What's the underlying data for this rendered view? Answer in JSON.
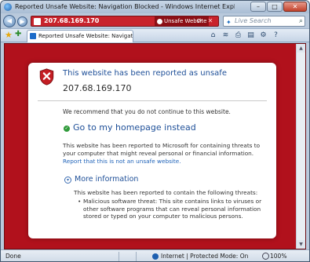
{
  "window": {
    "title": "Reported Unsafe Website: Navigation Blocked - Windows Internet Explorer",
    "controls": {
      "minimize": "–",
      "maximize": "□",
      "close": "✕"
    }
  },
  "address_bar": {
    "url": "207.68.169.170",
    "badge": "Unsafe Website",
    "accent_color": "#c8232c"
  },
  "search": {
    "placeholder": "Live Search",
    "provider_icon": "live-search-icon"
  },
  "tab": {
    "label": "Reported Unsafe Website: Navigation Blocked"
  },
  "page": {
    "heading": "This website has been reported as unsafe",
    "ip": "207.68.169.170",
    "recommendation": "We recommend that you do not continue to this website.",
    "home_link": "Go to my homepage instead",
    "reported_text": "This website has been reported to Microsoft for containing threats to your computer that might reveal personal or financial information.",
    "report_link": "Report that this is not an unsafe website.",
    "more_info": "More information",
    "threats_intro": "This website has been reported to contain the following threats:",
    "threats": [
      "Malicious software threat: This site contains links to viruses or other software programs that can reveal personal information stored or typed on your computer to malicious persons."
    ],
    "background_color": "#b1111c"
  },
  "status_bar": {
    "status": "Done",
    "zone": "Internet | Protected Mode: On",
    "zoom": "100%"
  }
}
